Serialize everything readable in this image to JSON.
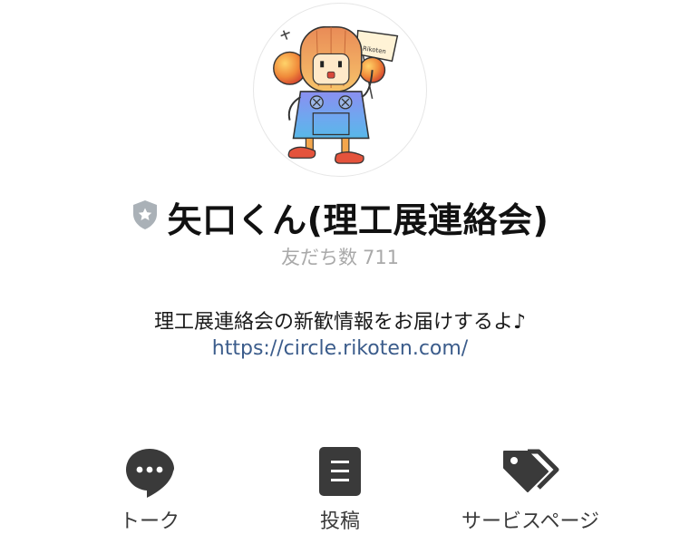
{
  "profile": {
    "name": "矢口くん(理工展連絡会)",
    "friends_label": "友だち数",
    "friends_count": "711",
    "description": "理工展連絡会の新歓情報をお届けするよ♪",
    "link": "https://circle.rikoten.com/",
    "avatar_flag_text": "Rikoten",
    "badge_icon": "shield-star-icon",
    "colors": {
      "badge": "#aab1b7",
      "link": "#3b5c8b",
      "icon": "#3a3a3a",
      "muted": "#a9a9a9"
    }
  },
  "actions": [
    {
      "label": "トーク",
      "icon": "chat-bubble-icon"
    },
    {
      "label": "投稿",
      "icon": "document-icon"
    },
    {
      "label": "サービスページ",
      "icon": "tags-icon"
    }
  ]
}
